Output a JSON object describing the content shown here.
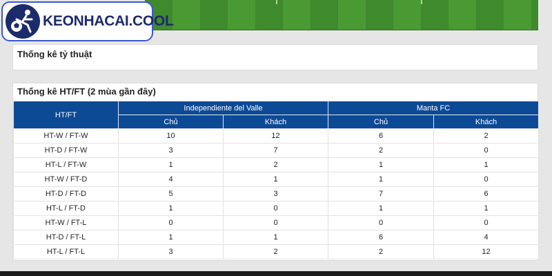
{
  "logo": {
    "text": "KEONHACAI.COOL"
  },
  "colors": {
    "header_blue": "#0d4a96",
    "logo_blue": "#1c2b6b",
    "field_green": "#4a9a33"
  },
  "section1": {
    "title": "Thống kê tỷ thuật"
  },
  "section2": {
    "title": "Thống kê HT/FT (2 mùa gần đây)",
    "table": {
      "col_htft": "HT/FT",
      "team1": "Independiente del Valle",
      "team2": "Manta FC",
      "home": "Chủ",
      "away": "Khách",
      "rows": [
        {
          "label": "HT-W / FT-W",
          "t1_home": "10",
          "t1_away": "12",
          "t2_home": "6",
          "t2_away": "2"
        },
        {
          "label": "HT-D / FT-W",
          "t1_home": "3",
          "t1_away": "7",
          "t2_home": "2",
          "t2_away": "0"
        },
        {
          "label": "HT-L / FT-W",
          "t1_home": "1",
          "t1_away": "2",
          "t2_home": "1",
          "t2_away": "1"
        },
        {
          "label": "HT-W / FT-D",
          "t1_home": "4",
          "t1_away": "1",
          "t2_home": "1",
          "t2_away": "0"
        },
        {
          "label": "HT-D / FT-D",
          "t1_home": "5",
          "t1_away": "3",
          "t2_home": "7",
          "t2_away": "6"
        },
        {
          "label": "HT-L / FT-D",
          "t1_home": "1",
          "t1_away": "0",
          "t2_home": "1",
          "t2_away": "1"
        },
        {
          "label": "HT-W / FT-L",
          "t1_home": "0",
          "t1_away": "0",
          "t2_home": "0",
          "t2_away": "0"
        },
        {
          "label": "HT-D / FT-L",
          "t1_home": "1",
          "t1_away": "1",
          "t2_home": "6",
          "t2_away": "4"
        },
        {
          "label": "HT-L / FT-L",
          "t1_home": "3",
          "t1_away": "2",
          "t2_home": "2",
          "t2_away": "12"
        }
      ]
    }
  }
}
